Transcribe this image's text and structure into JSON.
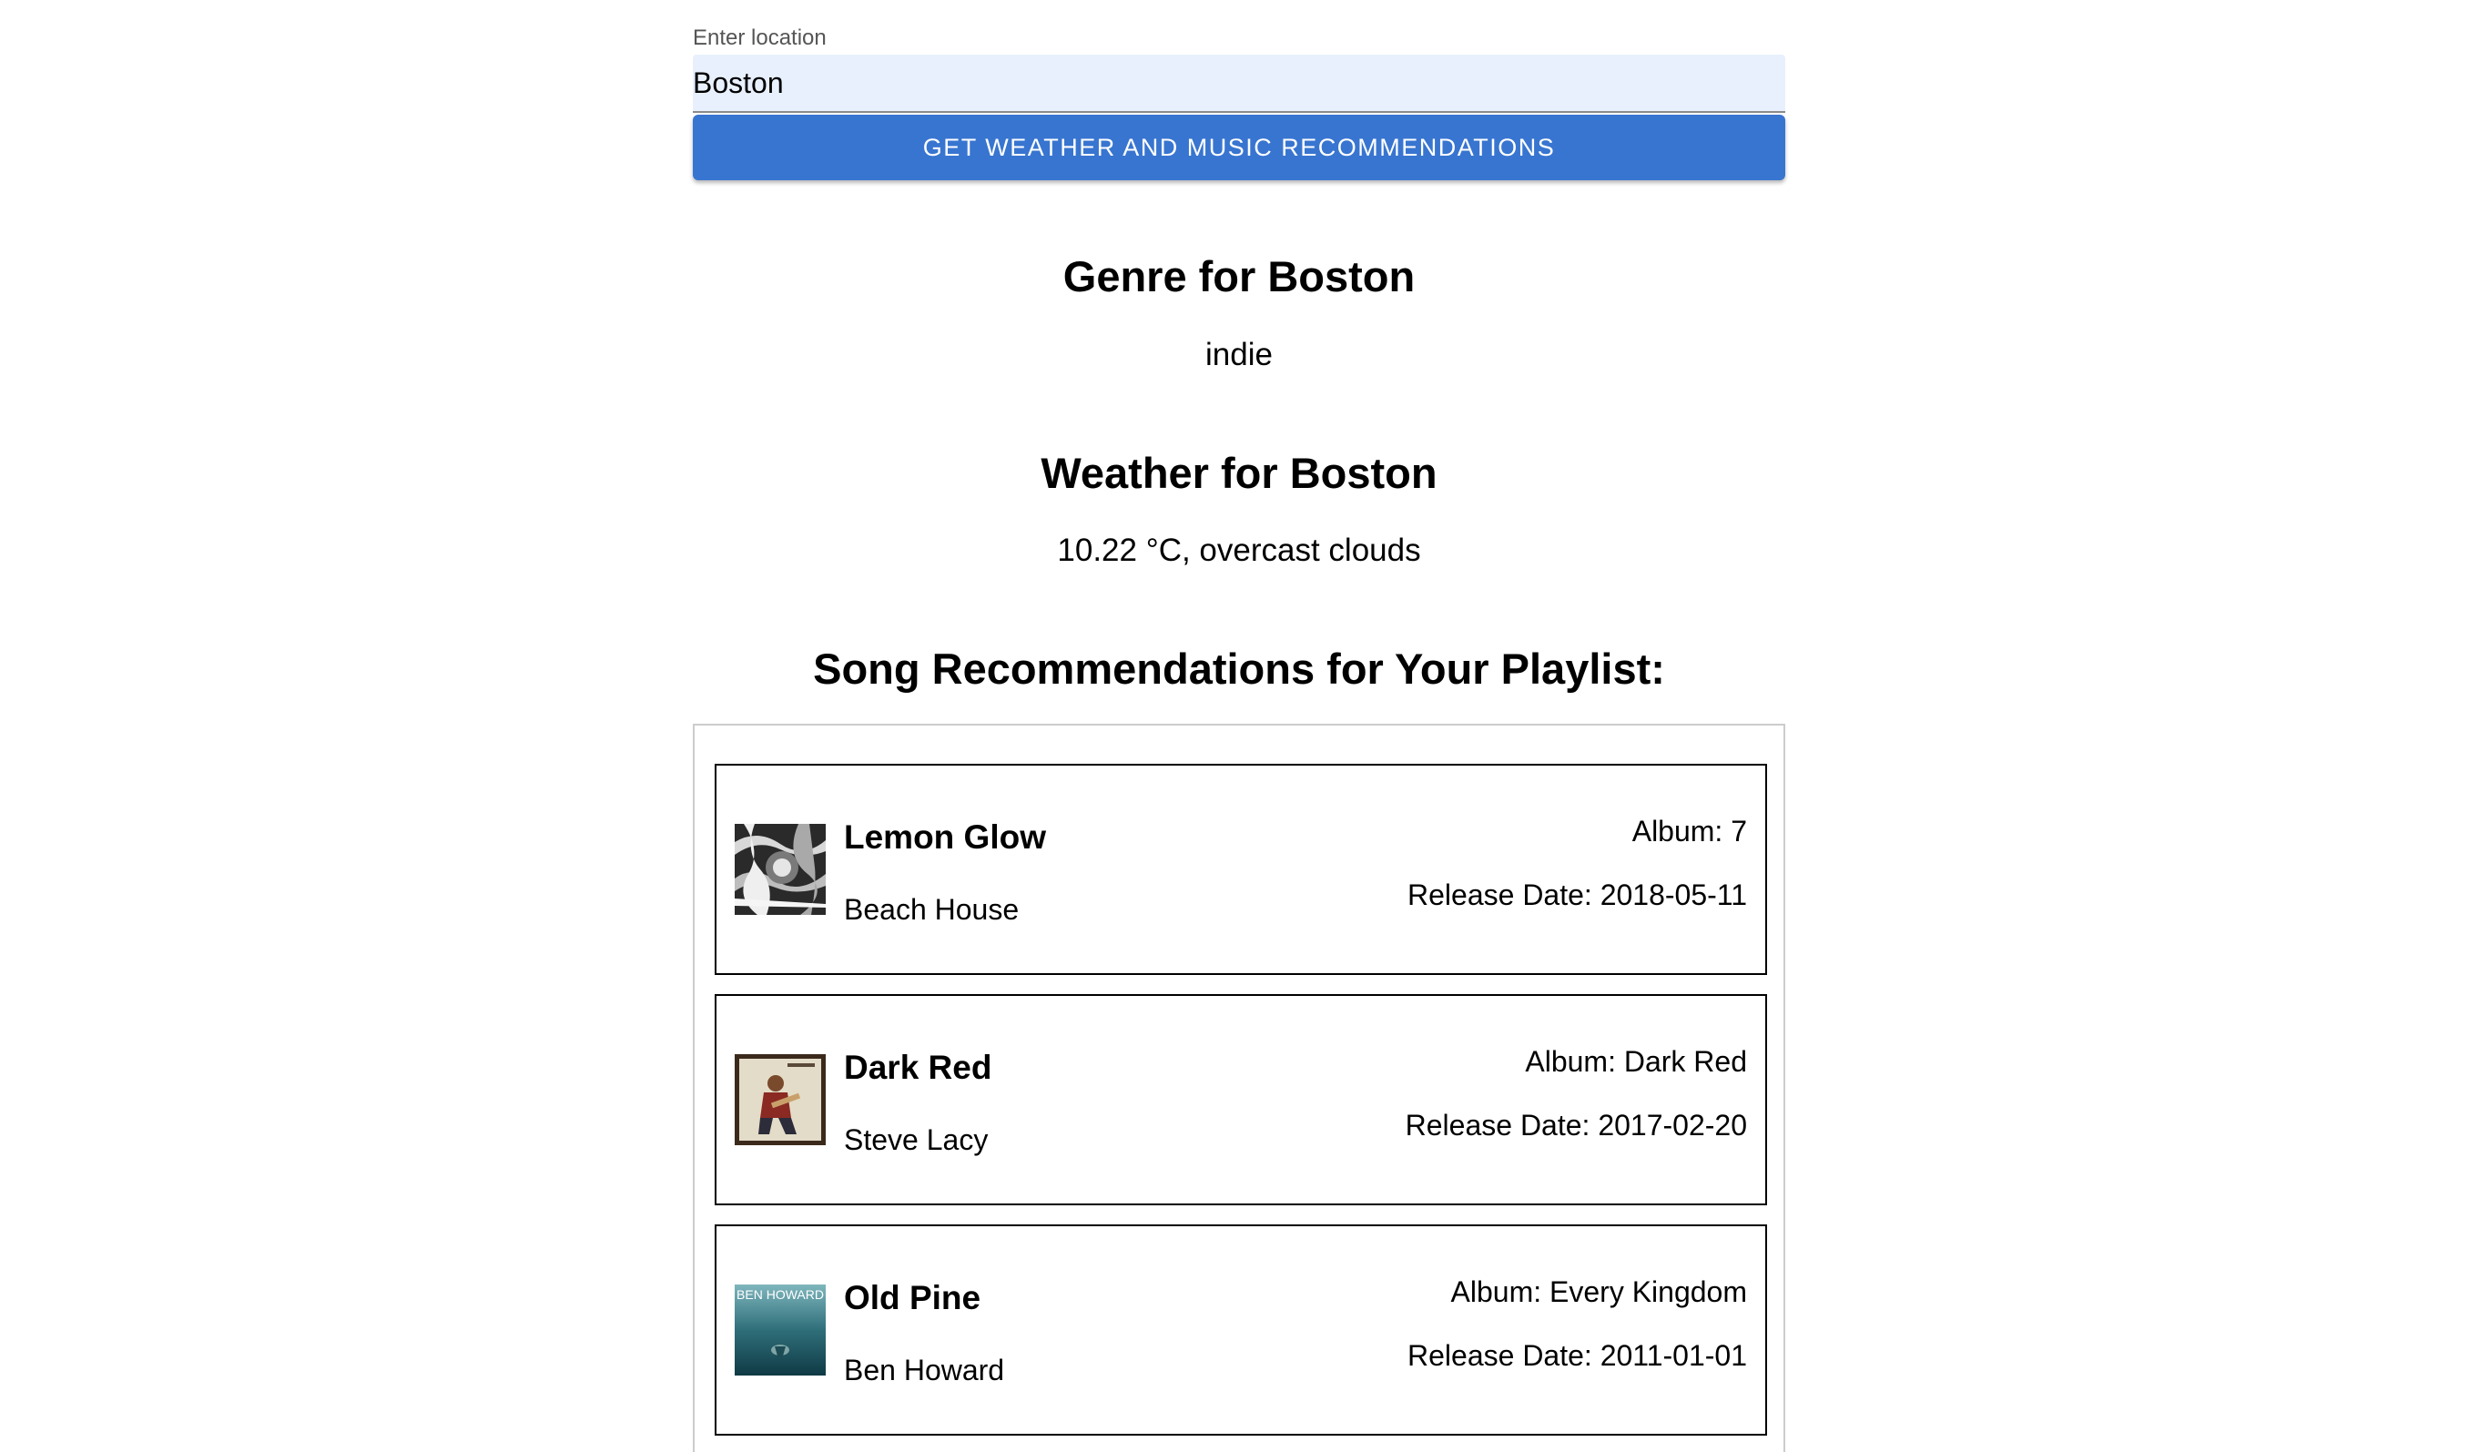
{
  "search": {
    "label": "Enter location",
    "value": "Boston"
  },
  "submit_label": "GET WEATHER AND MUSIC RECOMMENDATIONS",
  "genre": {
    "heading": "Genre for Boston",
    "value": "indie"
  },
  "weather": {
    "heading": "Weather for Boston",
    "value": "10.22 °C, overcast clouds"
  },
  "recommendations": {
    "heading": "Song Recommendations for Your Playlist:",
    "songs": [
      {
        "title": "Lemon Glow",
        "artist": "Beach House",
        "album": "Album: 7",
        "release": "Release Date: 2018-05-11"
      },
      {
        "title": "Dark Red",
        "artist": "Steve Lacy",
        "album": "Album: Dark Red",
        "release": "Release Date: 2017-02-20"
      },
      {
        "title": "Old Pine",
        "artist": "Ben Howard",
        "album": "Album: Every Kingdom",
        "release": "Release Date: 2011-01-01",
        "cover_text": "BEN HOWARD"
      }
    ]
  },
  "colors": {
    "accent": "#3875d0",
    "input_bg": "#e8f0fe"
  }
}
